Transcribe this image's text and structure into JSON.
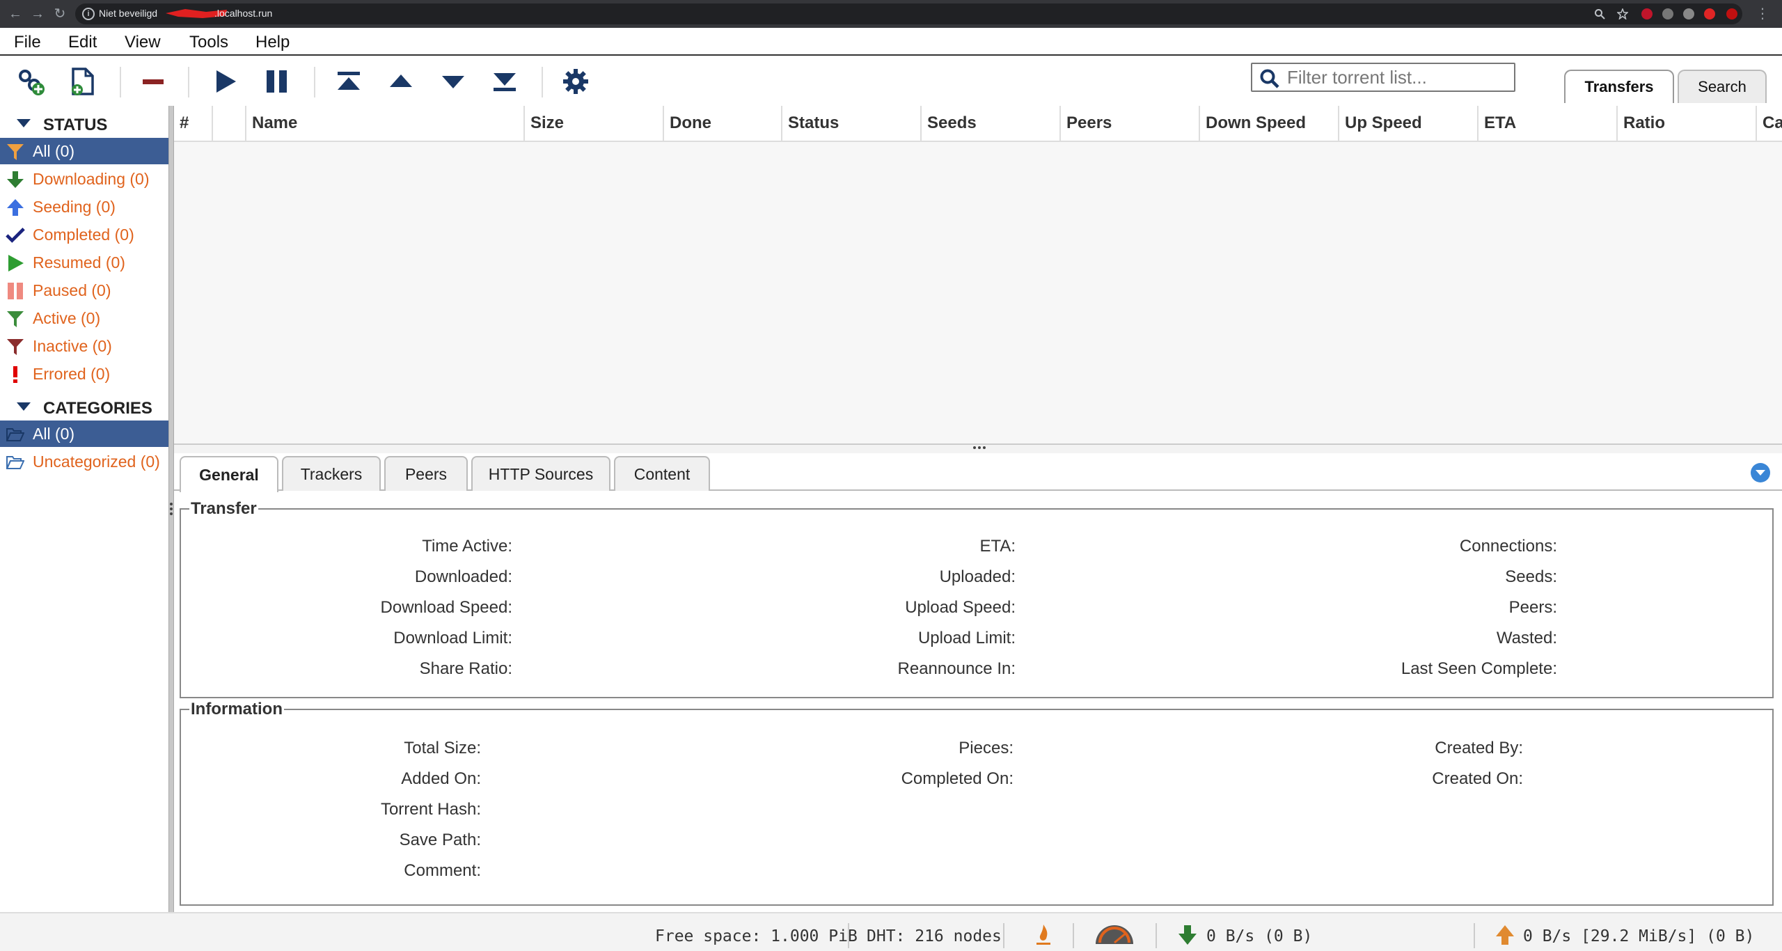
{
  "browser": {
    "security_label": "Niet beveiligd",
    "host": ".localhost.run"
  },
  "menu": {
    "file": "File",
    "edit": "Edit",
    "view": "View",
    "tools": "Tools",
    "help": "Help"
  },
  "toolbar": {
    "filter_placeholder": "Filter torrent list...",
    "tab_transfers": "Transfers",
    "tab_search": "Search",
    "icons": [
      "add-link-icon",
      "add-file-icon",
      "delete-icon",
      "start-icon",
      "pause-icon",
      "top-priority-icon",
      "increase-priority-icon",
      "decrease-priority-icon",
      "bottom-priority-icon",
      "options-gear-icon"
    ]
  },
  "sidebar": {
    "status_header": "STATUS",
    "status_items": [
      {
        "label": "All (0)",
        "icon": "filter-icon",
        "color": "#f0a040"
      },
      {
        "label": "Downloading (0)",
        "icon": "download-arrow-icon",
        "color": "#2e7d32"
      },
      {
        "label": "Seeding (0)",
        "icon": "upload-arrow-icon",
        "color": "#3b6fe0"
      },
      {
        "label": "Completed (0)",
        "icon": "checkmark-icon",
        "color": "#1a237e"
      },
      {
        "label": "Resumed (0)",
        "icon": "play-icon",
        "color": "#2e9d32"
      },
      {
        "label": "Paused (0)",
        "icon": "pause-icon",
        "color": "#ef8a80"
      },
      {
        "label": "Active (0)",
        "icon": "filter-icon",
        "color": "#3c8d3c"
      },
      {
        "label": "Inactive (0)",
        "icon": "filter-icon",
        "color": "#8b2d2d"
      },
      {
        "label": "Errored (0)",
        "icon": "exclamation-icon",
        "color": "#e00000"
      }
    ],
    "categories_header": "CATEGORIES",
    "category_items": [
      {
        "label": "All (0)",
        "icon": "folder-open-icon"
      },
      {
        "label": "Uncategorized (0)",
        "icon": "folder-open-icon"
      }
    ]
  },
  "list": {
    "columns": [
      "#",
      "",
      "Name",
      "Size",
      "Done",
      "Status",
      "Seeds",
      "Peers",
      "Down Speed",
      "Up Speed",
      "ETA",
      "Ratio",
      "Ca"
    ]
  },
  "properties": {
    "tabs": [
      "General",
      "Trackers",
      "Peers",
      "HTTP Sources",
      "Content"
    ],
    "transfer": {
      "title": "Transfer",
      "col1": [
        "Time Active:",
        "Downloaded:",
        "Download Speed:",
        "Download Limit:",
        "Share Ratio:"
      ],
      "col2": [
        "ETA:",
        "Uploaded:",
        "Upload Speed:",
        "Upload Limit:",
        "Reannounce In:"
      ],
      "col3": [
        "Connections:",
        "Seeds:",
        "Peers:",
        "Wasted:",
        "Last Seen Complete:"
      ]
    },
    "information": {
      "title": "Information",
      "col1": [
        "Total Size:",
        "Added On:",
        "Torrent Hash:",
        "Save Path:",
        "Comment:"
      ],
      "col2": [
        "Pieces:",
        "Completed On:"
      ],
      "col3": [
        "Created By:",
        "Created On:"
      ]
    }
  },
  "statusbar": {
    "free_space": "Free space: 1.000 PiB",
    "dht": "DHT: 216 nodes",
    "download": "0 B/s (0 B)",
    "upload": "0 B/s [29.2 MiB/s] (0 B)"
  },
  "colors": {
    "selection": "#3c5d94",
    "link_orange": "#e0631d",
    "toolbar_blue": "#1a3866"
  }
}
